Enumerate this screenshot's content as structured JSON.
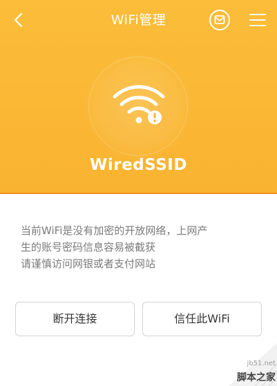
{
  "header": {
    "title": "WiFi管理",
    "back_icon": "chevron-left-icon",
    "mail_icon": "mail-badge-icon",
    "menu_icon": "hamburger-menu-icon"
  },
  "network": {
    "ssid": "WiredSSID",
    "icon": "wifi-warning-icon",
    "status": "insecure"
  },
  "warning": {
    "lines": [
      "当前WiFi是没有加密的开放网络，上网产",
      "生的账号密码信息容易被截获",
      "请谨慎访问网银或者支付网站"
    ]
  },
  "actions": {
    "disconnect_label": "断开连接",
    "trust_label": "信任此WiFi"
  },
  "watermark": {
    "site": "jb51.net",
    "brand": "脚本之家"
  },
  "colors": {
    "primary": "#f9b330",
    "accent_line": "#ef8d1f",
    "text_secondary": "#7a7a7a",
    "button_border": "#d3d3d3"
  }
}
